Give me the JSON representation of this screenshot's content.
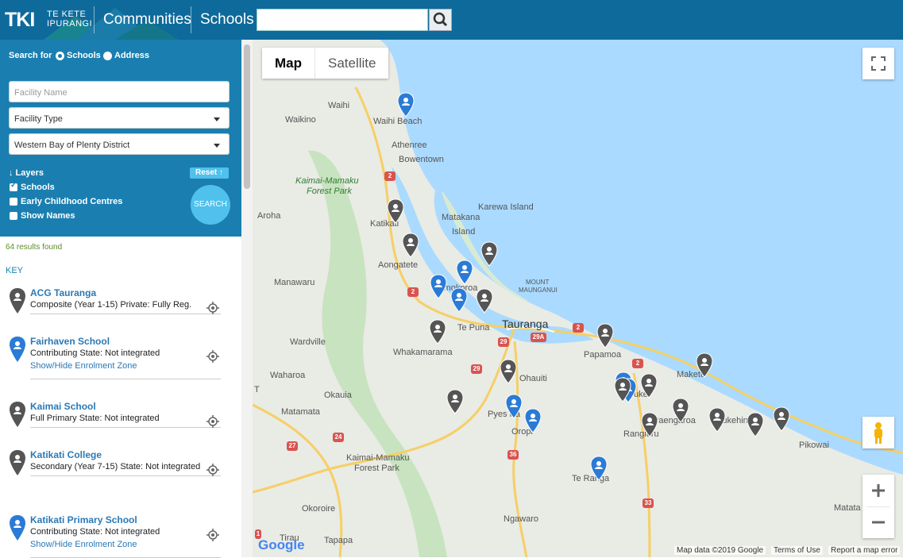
{
  "header": {
    "logo_main": "TKI",
    "logo_sub_1": "TE KETE",
    "logo_sub_2": "IPURANGI",
    "nav_1": "Communities",
    "nav_2": "Schools",
    "search_value": "",
    "search_icon": "search-icon"
  },
  "filters": {
    "search_for_label": "Search for",
    "option_schools": "Schools",
    "option_address": "Address",
    "selected": "Schools",
    "facility_name_placeholder": "Facility Name",
    "facility_type_value": "Facility Type",
    "district_value": "Western Bay of Plenty District",
    "layers_label": "↓ Layers",
    "reset_label": "Reset ↑",
    "layer_schools": "Schools",
    "layer_ecc": "Early Childhood Centres",
    "layer_names": "Show Names",
    "search_label": "SEARCH"
  },
  "results": {
    "count_text": "64 results found",
    "key_label": "KEY",
    "items": [
      {
        "title": "ACG Tauranga",
        "desc": "Composite (Year 1-15) Private: Fully Reg.",
        "link": "",
        "pin_color": "#555555"
      },
      {
        "title": "Fairhaven School",
        "desc": "Contributing State: Not integrated",
        "link": "Show/Hide Enrolment Zone",
        "pin_color": "#2b7bd6"
      },
      {
        "title": "Kaimai School",
        "desc": "Full Primary State: Not integrated",
        "link": "",
        "pin_color": "#555555"
      },
      {
        "title": "Katikati College",
        "desc": "Secondary (Year 7-15) State: Not integrated",
        "link": "",
        "pin_color": "#555555"
      },
      {
        "title": "Katikati Primary School",
        "desc": "Contributing State: Not integrated",
        "link": "Show/Hide Enrolment Zone",
        "pin_color": "#2b7bd6"
      }
    ]
  },
  "map": {
    "map_type_map": "Map",
    "map_type_satellite": "Satellite",
    "labels": {
      "waihi": "Waihi",
      "waihi_beach": "Waihi Beach",
      "waikino": "Waikino",
      "athenree": "Athenree",
      "bowentown": "Bowentown",
      "kaimai_forest": "Kaimai-Mamaku",
      "kaimai_forest_2": "Forest Park",
      "karewa": "Karewa Island",
      "aroha": "Aroha",
      "matakana": "Matakana",
      "island": "Island",
      "katikati": "Katikati",
      "aongatete": "Aongatete",
      "manawaru": "Manawaru",
      "omokoroa": "Omokoroa",
      "mount": "MOUNT",
      "maunganui": "MAUNGANUI",
      "te_puna": "Te Puna",
      "tauranga": "Tauranga",
      "wardville": "Wardville",
      "whakamarama": "Whakamarama",
      "papamoa": "Papamoa",
      "ohauiti": "Ohauiti",
      "maketu": "Maketu",
      "waharoa": "Waharoa",
      "okauia": "Okauia",
      "te_puke": "Te Puke",
      "matamata": "Matamata",
      "pyes_pa": "Pyes Pa",
      "paengaroa": "Paengaroa",
      "pukehina": "Pukehina",
      "oropi": "Oropi",
      "rangiuru": "Rangiuru",
      "kaimai_2": "Kaimai-Mamaku",
      "kaimai_2b": "Forest Park",
      "pikowai": "Pikowai",
      "te_ranga": "Te Ranga",
      "okoroire": "Okoroire",
      "ngawaro": "Ngawaro",
      "matata": "Matata",
      "tirau": "Tirau",
      "tapapa": "Tapapa",
      "t_letter": "T"
    },
    "routes": {
      "r2a": "2",
      "r2b": "2",
      "r2c": "2",
      "r2d": "2",
      "r29a": "29",
      "r29b": "29",
      "r29c": "29A",
      "r27": "27",
      "r24": "24",
      "r36": "36",
      "r33": "33",
      "r1": "1"
    },
    "attribution": {
      "google": "Google",
      "map_data": "Map data ©2019 Google",
      "terms": "Terms of Use",
      "report": "Report a map error"
    }
  }
}
